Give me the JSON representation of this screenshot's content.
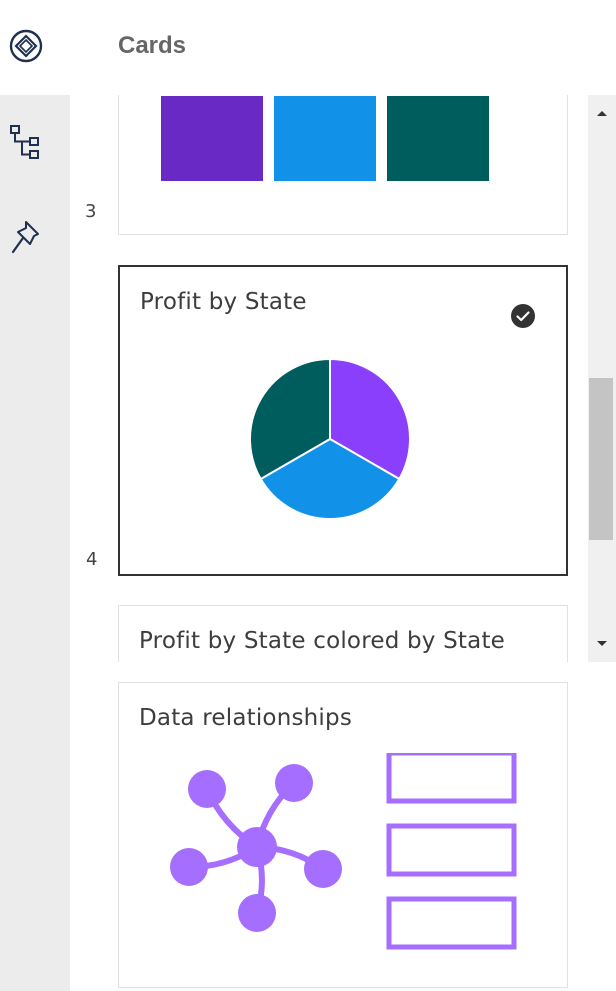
{
  "header": {
    "title": "Cards"
  },
  "rail": {
    "items": [
      {
        "icon": "compass-diamond-icon"
      },
      {
        "icon": "hierarchy-icon"
      },
      {
        "icon": "pin-icon"
      }
    ]
  },
  "cards": [
    {
      "number": "3",
      "swatch_colors": [
        "#6929c4",
        "#1192e8",
        "#005d5d"
      ]
    },
    {
      "number": "4",
      "title": "Profit by State",
      "selected": true,
      "status_icon": "checkmark-filled-icon",
      "pie_colors": [
        "#8a3ffc",
        "#1192e8",
        "#005d5d"
      ]
    },
    {
      "title": "Profit by State colored by State"
    }
  ],
  "bottom_card": {
    "title": "Data relationships",
    "illustration_color": "#a56eff"
  }
}
